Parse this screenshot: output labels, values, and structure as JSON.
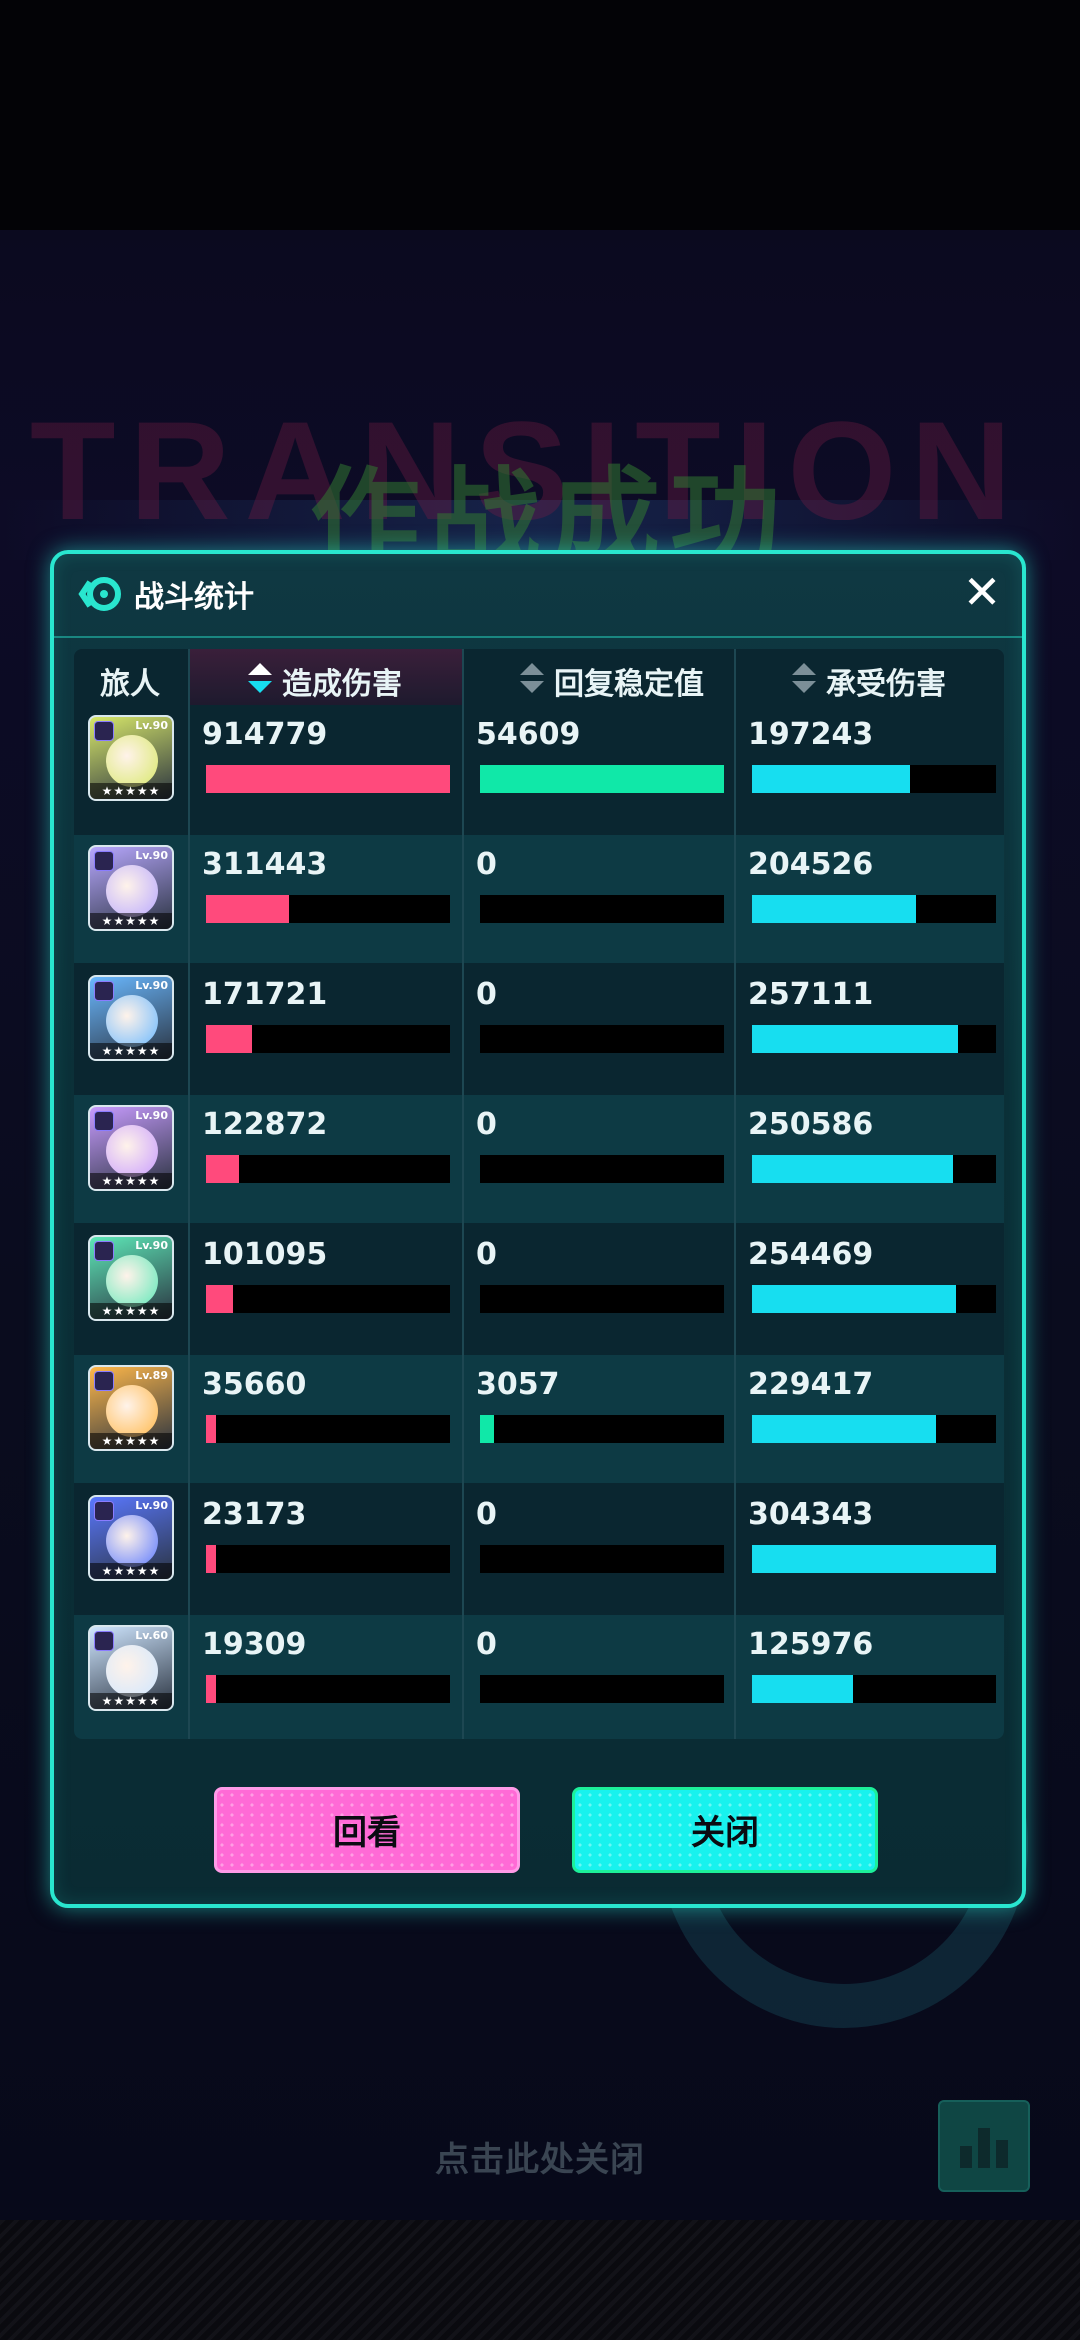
{
  "background": {
    "ghost_text": "TRANSITION",
    "title_text": "作战成功",
    "tap_to_close": "点击此处关闭"
  },
  "panel": {
    "title": "战斗统计",
    "close_label": "✕"
  },
  "table": {
    "headers": {
      "traveler": "旅人",
      "damage_dealt": "造成伤害",
      "stability_restored": "回复稳定值",
      "damage_taken": "承受伤害"
    },
    "active_sort": "damage_dealt",
    "max": {
      "damage_dealt": 914779,
      "stability_restored": 54609,
      "damage_taken": 304343
    },
    "rows": [
      {
        "level": "Lv.90",
        "stars": "★★★★★",
        "damage_dealt": "914779",
        "stability_restored": "54609",
        "damage_taken": "197243",
        "color": "#d8e86a"
      },
      {
        "level": "Lv.90",
        "stars": "★★★★★",
        "damage_dealt": "311443",
        "stability_restored": "0",
        "damage_taken": "204526",
        "color": "#b8a8ff"
      },
      {
        "level": "Lv.90",
        "stars": "★★★★★",
        "damage_dealt": "171721",
        "stability_restored": "0",
        "damage_taken": "257111",
        "color": "#6ab8ff"
      },
      {
        "level": "Lv.90",
        "stars": "★★★★★",
        "damage_dealt": "122872",
        "stability_restored": "0",
        "damage_taken": "250586",
        "color": "#c89cff"
      },
      {
        "level": "Lv.90",
        "stars": "★★★★★",
        "damage_dealt": "101095",
        "stability_restored": "0",
        "damage_taken": "254469",
        "color": "#5ee8b8"
      },
      {
        "level": "Lv.89",
        "stars": "★★★★★",
        "damage_dealt": "35660",
        "stability_restored": "3057",
        "damage_taken": "229417",
        "color": "#ffb84a"
      },
      {
        "level": "Lv.90",
        "stars": "★★★★★",
        "damage_dealt": "23173",
        "stability_restored": "0",
        "damage_taken": "304343",
        "color": "#5a78ff"
      },
      {
        "level": "Lv.60",
        "stars": "★★★★★",
        "damage_dealt": "19309",
        "stability_restored": "0",
        "damage_taken": "125976",
        "color": "#cfe6ff"
      }
    ]
  },
  "buttons": {
    "replay": "回看",
    "close": "关闭"
  }
}
